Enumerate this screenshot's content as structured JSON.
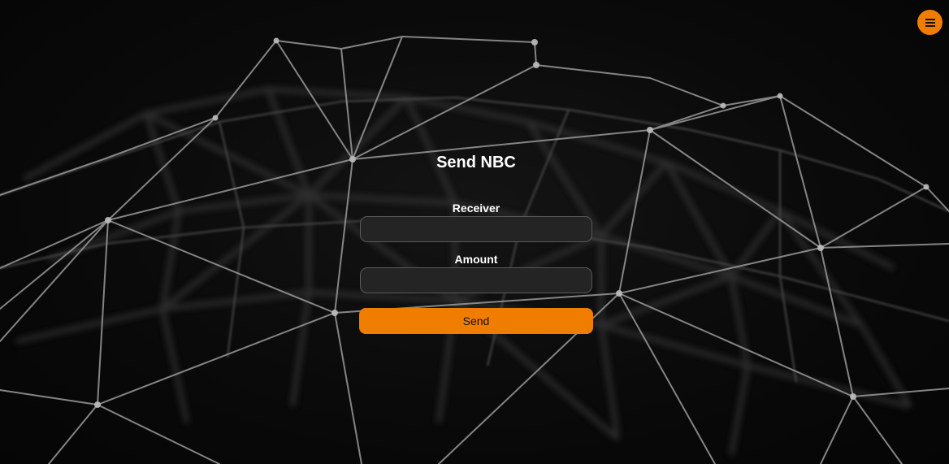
{
  "header": {
    "menu_icon": "hamburger-menu-icon",
    "accent_color": "#f07d00"
  },
  "form": {
    "title": "Send NBC",
    "receiver_label": "Receiver",
    "receiver_value": "",
    "amount_label": "Amount",
    "amount_value": "",
    "send_label": "Send"
  },
  "background": {
    "description_icon": "network-mesh-background"
  }
}
